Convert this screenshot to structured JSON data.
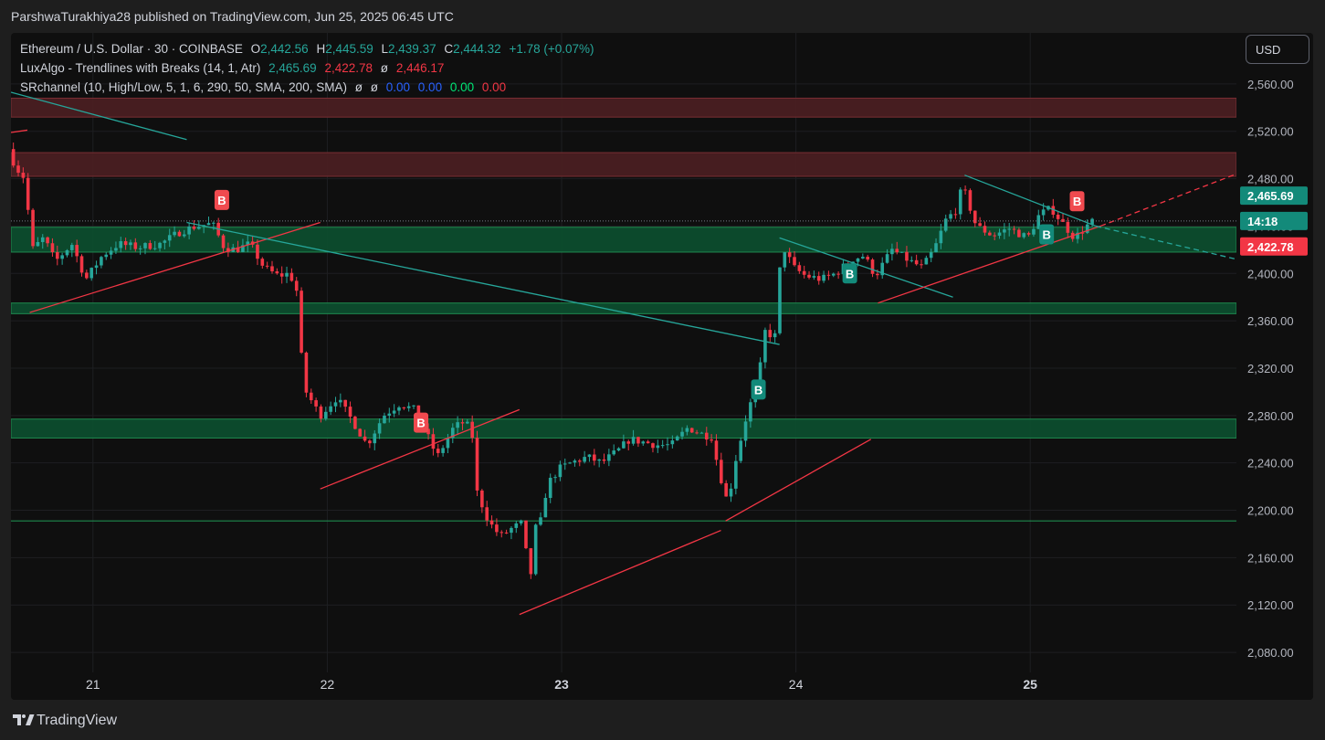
{
  "header": {
    "publish_info": "ParshwaTurakhiya28 published on TradingView.com, Jun 25, 2025 06:45 UTC"
  },
  "legend": {
    "symbol": {
      "title": "Ethereum / U.S. Dollar · 30 · COINBASE",
      "o_label": "O",
      "o_value": "2,442.56",
      "h_label": "H",
      "h_value": "2,445.59",
      "l_label": "L",
      "l_value": "2,439.37",
      "c_label": "C",
      "c_value": "2,444.32",
      "change": "+1.78 (+0.07%)"
    },
    "luxalgo": {
      "title": "LuxAlgo - Trendlines with Breaks (14, 1, Atr)",
      "v1": "2,465.69",
      "v2": "2,422.78",
      "v3": "ø",
      "v4": "2,446.17"
    },
    "srchannel": {
      "title": "SRchannel (10, High/Low, 5, 1, 6, 290, 50, SMA, 200, SMA)",
      "n1": "ø",
      "n2": "ø",
      "v1": "0.00",
      "v2": "0.00",
      "v3": "0.00",
      "v4": "0.00"
    }
  },
  "currency_button": "USD",
  "footer": {
    "brand": "TradingView"
  },
  "colors": {
    "up": "#26a69a",
    "down": "#f23645",
    "zone_red": "#4a1f22",
    "zone_green": "#0d4d2e",
    "teal_line": "#26a69a",
    "red_line": "#f23645"
  },
  "chart_data": {
    "type": "candlestick",
    "symbol": "Ethereum / U.S. Dollar",
    "interval": "30",
    "exchange": "COINBASE",
    "ylim": [
      2060,
      2590
    ],
    "y_ticks": [
      {
        "value": 2560,
        "label": "2,560.00"
      },
      {
        "value": 2520,
        "label": "2,520.00"
      },
      {
        "value": 2480,
        "label": "2,480.00"
      },
      {
        "value": 2440,
        "label": "2,440.00"
      },
      {
        "value": 2400,
        "label": "2,400.00"
      },
      {
        "value": 2360,
        "label": "2,360.00"
      },
      {
        "value": 2320,
        "label": "2,320.00"
      },
      {
        "value": 2280,
        "label": "2,280.00"
      },
      {
        "value": 2240,
        "label": "2,240.00"
      },
      {
        "value": 2200,
        "label": "2,200.00"
      },
      {
        "value": 2160,
        "label": "2,160.00"
      },
      {
        "value": 2120,
        "label": "2,120.00"
      },
      {
        "value": 2080,
        "label": "2,080.00"
      }
    ],
    "xlim": [
      20.65,
      25.88
    ],
    "x_ticks": [
      {
        "value": 21,
        "label": "21",
        "bold": false
      },
      {
        "value": 22,
        "label": "22",
        "bold": false
      },
      {
        "value": 23,
        "label": "23",
        "bold": true
      },
      {
        "value": 24,
        "label": "24",
        "bold": false
      },
      {
        "value": 25,
        "label": "25",
        "bold": true
      }
    ],
    "grid": true,
    "price_path": [
      [
        20.65,
        2505
      ],
      [
        20.68,
        2490
      ],
      [
        20.72,
        2480
      ],
      [
        20.75,
        2420
      ],
      [
        20.8,
        2430
      ],
      [
        20.85,
        2410
      ],
      [
        20.92,
        2425
      ],
      [
        20.98,
        2395
      ],
      [
        21.05,
        2415
      ],
      [
        21.12,
        2425
      ],
      [
        21.2,
        2422
      ],
      [
        21.3,
        2425
      ],
      [
        21.38,
        2435
      ],
      [
        21.45,
        2440
      ],
      [
        21.52,
        2442
      ],
      [
        21.57,
        2422
      ],
      [
        21.62,
        2420
      ],
      [
        21.68,
        2425
      ],
      [
        21.74,
        2405
      ],
      [
        21.8,
        2398
      ],
      [
        21.85,
        2400
      ],
      [
        21.88,
        2385
      ],
      [
        21.9,
        2330
      ],
      [
        21.92,
        2300
      ],
      [
        21.98,
        2280
      ],
      [
        22.05,
        2295
      ],
      [
        22.12,
        2275
      ],
      [
        22.18,
        2255
      ],
      [
        22.25,
        2280
      ],
      [
        22.32,
        2290
      ],
      [
        22.38,
        2285
      ],
      [
        22.44,
        2262
      ],
      [
        22.48,
        2245
      ],
      [
        22.55,
        2270
      ],
      [
        22.6,
        2275
      ],
      [
        22.63,
        2262
      ],
      [
        22.65,
        2215
      ],
      [
        22.7,
        2190
      ],
      [
        22.75,
        2178
      ],
      [
        22.8,
        2185
      ],
      [
        22.85,
        2190
      ],
      [
        22.87,
        2130
      ],
      [
        22.9,
        2185
      ],
      [
        22.92,
        2190
      ],
      [
        22.95,
        2222
      ],
      [
        23.0,
        2235
      ],
      [
        23.05,
        2240
      ],
      [
        23.12,
        2245
      ],
      [
        23.18,
        2240
      ],
      [
        23.25,
        2250
      ],
      [
        23.3,
        2260
      ],
      [
        23.35,
        2258
      ],
      [
        23.42,
        2255
      ],
      [
        23.48,
        2255
      ],
      [
        23.55,
        2270
      ],
      [
        23.6,
        2265
      ],
      [
        23.65,
        2262
      ],
      [
        23.68,
        2235
      ],
      [
        23.72,
        2205
      ],
      [
        23.75,
        2240
      ],
      [
        23.8,
        2280
      ],
      [
        23.85,
        2310
      ],
      [
        23.88,
        2352
      ],
      [
        23.92,
        2345
      ],
      [
        23.95,
        2425
      ],
      [
        24.0,
        2405
      ],
      [
        24.05,
        2398
      ],
      [
        24.12,
        2395
      ],
      [
        24.18,
        2400
      ],
      [
        24.25,
        2412
      ],
      [
        24.3,
        2415
      ],
      [
        24.35,
        2398
      ],
      [
        24.42,
        2420
      ],
      [
        24.5,
        2410
      ],
      [
        24.55,
        2405
      ],
      [
        24.6,
        2420
      ],
      [
        24.65,
        2445
      ],
      [
        24.7,
        2455
      ],
      [
        24.72,
        2475
      ],
      [
        24.78,
        2440
      ],
      [
        24.85,
        2432
      ],
      [
        24.92,
        2438
      ],
      [
        25.0,
        2430
      ],
      [
        25.05,
        2450
      ],
      [
        25.1,
        2455
      ],
      [
        25.15,
        2442
      ],
      [
        25.2,
        2430
      ],
      [
        25.25,
        2440
      ],
      [
        25.28,
        2444
      ]
    ],
    "zones": [
      {
        "low": 2532,
        "high": 2548,
        "color": "red"
      },
      {
        "low": 2482,
        "high": 2502,
        "color": "red"
      },
      {
        "low": 2418,
        "high": 2439,
        "color": "green"
      },
      {
        "low": 2366,
        "high": 2375,
        "color": "green"
      },
      {
        "low": 2261,
        "high": 2277,
        "color": "green"
      }
    ],
    "support_line": {
      "value": 2191
    },
    "trendlines": [
      {
        "kind": "teal",
        "from": [
          20.65,
          2553
        ],
        "to": [
          21.4,
          2513
        ]
      },
      {
        "kind": "red",
        "from": [
          20.65,
          2519
        ],
        "to": [
          20.72,
          2521
        ]
      },
      {
        "kind": "red",
        "from": [
          20.73,
          2367
        ],
        "to": [
          21.97,
          2443
        ]
      },
      {
        "kind": "teal",
        "from": [
          21.4,
          2443
        ],
        "to": [
          23.93,
          2340
        ]
      },
      {
        "kind": "red",
        "from": [
          21.97,
          2218
        ],
        "to": [
          22.82,
          2285
        ]
      },
      {
        "kind": "red",
        "from": [
          22.82,
          2112
        ],
        "to": [
          23.68,
          2183
        ]
      },
      {
        "kind": "red",
        "from": [
          23.7,
          2191
        ],
        "to": [
          24.32,
          2260
        ]
      },
      {
        "kind": "teal",
        "from": [
          23.93,
          2430
        ],
        "to": [
          24.67,
          2380
        ]
      },
      {
        "kind": "red",
        "from": [
          24.35,
          2375
        ],
        "to": [
          25.3,
          2440
        ]
      },
      {
        "kind": "red_dashed",
        "from": [
          25.3,
          2440
        ],
        "to": [
          25.88,
          2484
        ]
      },
      {
        "kind": "teal",
        "from": [
          24.72,
          2483
        ],
        "to": [
          25.28,
          2440
        ]
      },
      {
        "kind": "teal_dashed",
        "from": [
          25.28,
          2440
        ],
        "to": [
          25.88,
          2412
        ]
      }
    ],
    "current_price_line": 2444.32,
    "markers": [
      {
        "x": 21.55,
        "price": 2462,
        "label": "B",
        "kind": "red"
      },
      {
        "x": 22.4,
        "price": 2274,
        "label": "B",
        "kind": "red"
      },
      {
        "x": 23.84,
        "price": 2302,
        "label": "B",
        "kind": "green"
      },
      {
        "x": 24.23,
        "price": 2400,
        "label": "B",
        "kind": "green"
      },
      {
        "x": 25.07,
        "price": 2433,
        "label": "B",
        "kind": "green"
      },
      {
        "x": 25.2,
        "price": 2461,
        "label": "B",
        "kind": "red"
      }
    ],
    "price_tags": [
      {
        "value": 2465.69,
        "label": "2,465.69",
        "kind": "green"
      },
      {
        "value": 2444.32,
        "label": "14:18",
        "kind": "green"
      },
      {
        "value": 2422.78,
        "label": "2,422.78",
        "kind": "red"
      }
    ]
  }
}
